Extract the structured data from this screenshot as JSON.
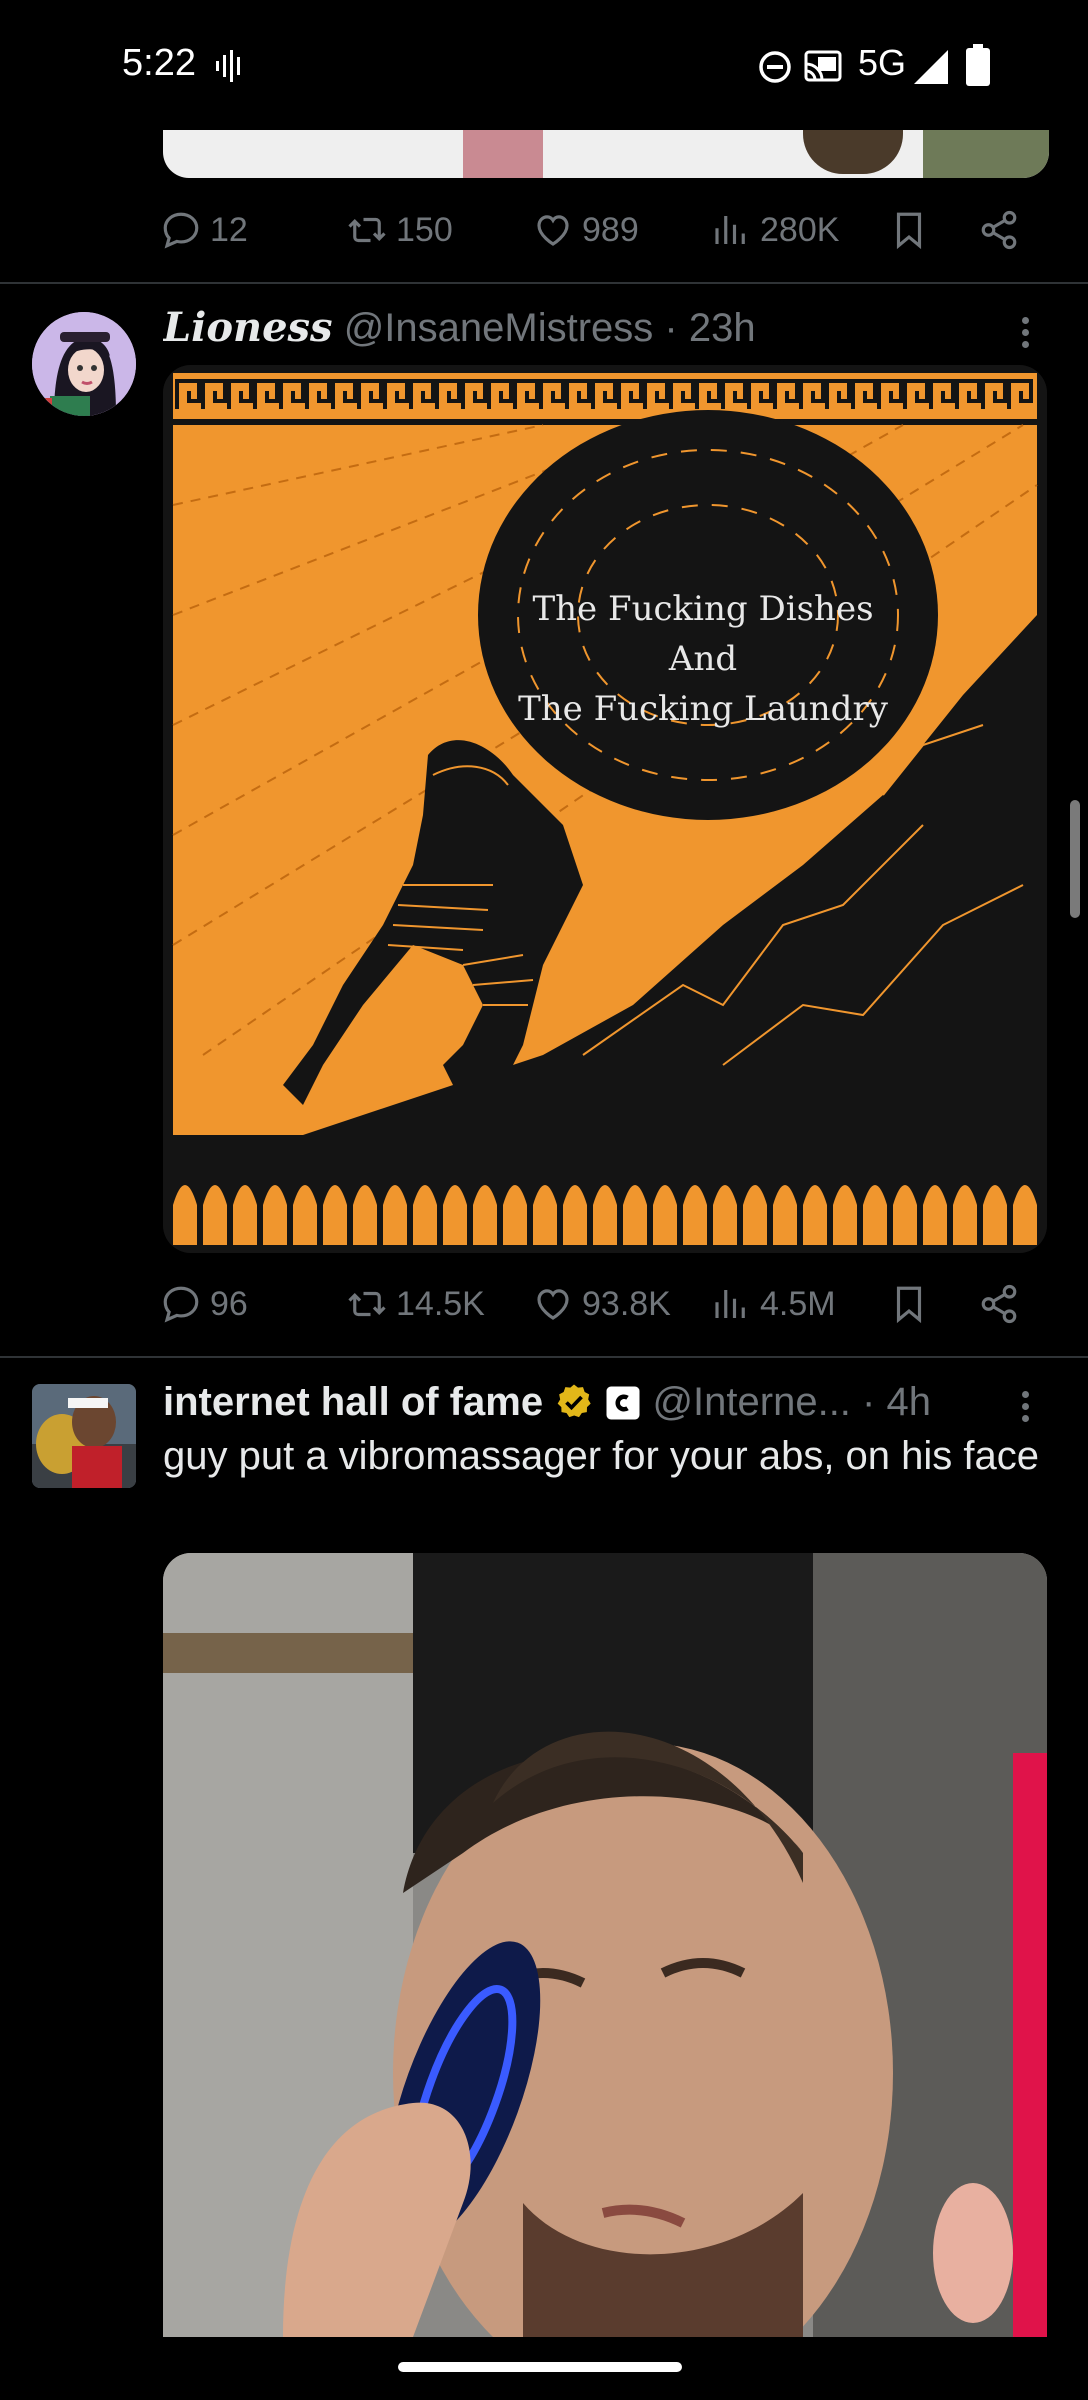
{
  "status_bar": {
    "time": "5:22",
    "network": "5G",
    "icons": [
      "voice-activity-icon",
      "dnd-icon",
      "cast-icon",
      "signal-icon",
      "battery-icon"
    ]
  },
  "top_tweet_actions": {
    "replies": "12",
    "retweets": "150",
    "likes": "989",
    "views": "280K"
  },
  "tweet1": {
    "display_name": "Lioness",
    "handle": "@InsaneMistress",
    "time": "· 23h",
    "image_text": {
      "line1": "The Fucking Dishes",
      "line2": "And",
      "line3": "The Fucking Laundry"
    },
    "actions": {
      "replies": "96",
      "retweets": "14.5K",
      "likes": "93.8K",
      "views": "4.5M"
    }
  },
  "tweet2": {
    "display_name": "internet hall of fame",
    "handle": "@Interne...",
    "time": "· 4h",
    "text": "guy put a vibromassager for your abs, on his face"
  },
  "colors": {
    "background": "#000000",
    "muted": "#71767b",
    "verified_gold": "#e2b719",
    "orange": "#f0962e"
  }
}
